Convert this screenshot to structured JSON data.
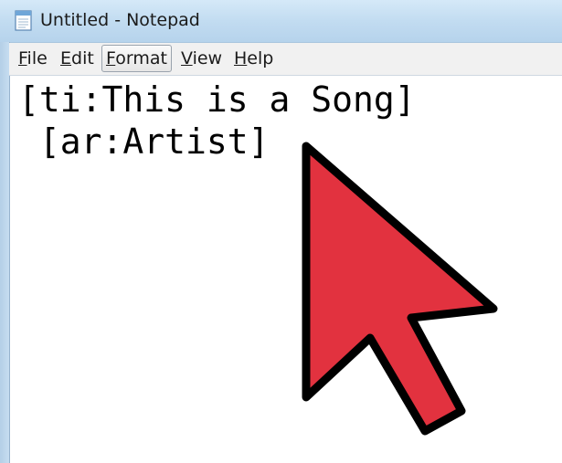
{
  "window": {
    "title": "Untitled - Notepad",
    "app_icon": "notepad-icon"
  },
  "menu": {
    "items": [
      {
        "accel": "F",
        "rest": "ile"
      },
      {
        "accel": "E",
        "rest": "dit"
      },
      {
        "accel": "F",
        "rest": "ormat"
      },
      {
        "accel": "V",
        "rest": "iew"
      },
      {
        "accel": "H",
        "rest": "elp"
      }
    ]
  },
  "editor": {
    "lines": [
      "[ti:This is a Song]",
      " [ar:Artist]"
    ]
  },
  "overlay": {
    "icon": "arrow-cursor-icon",
    "fill_color": "#e2323f",
    "stroke_color": "#000000"
  },
  "colors": {
    "titlebar": "#c2dcf1",
    "menubar": "#f1f1f1"
  }
}
